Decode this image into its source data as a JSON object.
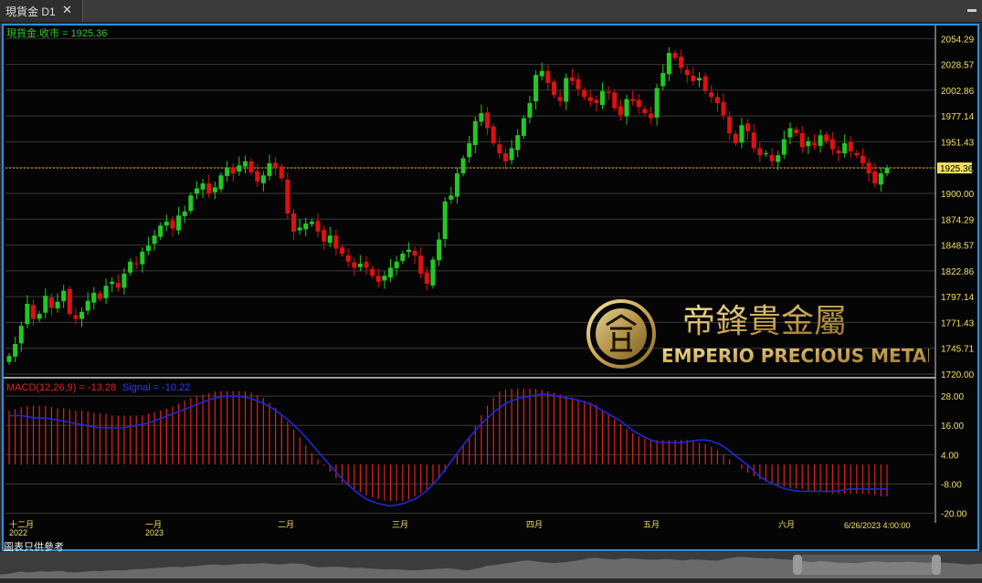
{
  "window": {
    "tab_title": "現貨金 D1",
    "close_glyph": "✕",
    "menu_glyph": "▬"
  },
  "colors": {
    "bull": "#23c823",
    "bear": "#e01010",
    "macd_hist": "#e02020",
    "signal": "#1b2ad8",
    "price_line": "#e0a020",
    "grid": "#3a3a3a",
    "axis_text": "#f0e060"
  },
  "price_panel": {
    "legend": "現貨金.收市 = 1925.36",
    "current_price": "1925.36",
    "y_ticks": [
      "2054.29",
      "2028.57",
      "2002.86",
      "1977.14",
      "1951.43",
      "1925.71",
      "1900.00",
      "1874.29",
      "1848.57",
      "1822.86",
      "1797.14",
      "1771.43",
      "1745.71",
      "1720.00"
    ]
  },
  "macd_panel": {
    "legend_macd": "MACD(12,26,9) = -13.28",
    "legend_signal": "Signal = -10.22",
    "y_ticks": [
      "28.00",
      "16.00",
      "4.00",
      "-8.00",
      "-20.00"
    ]
  },
  "x_axis": {
    "labels": [
      {
        "text": "十二月",
        "sub": "2022"
      },
      {
        "text": "一月",
        "sub": "2023"
      },
      {
        "text": "二月",
        "sub": ""
      },
      {
        "text": "三月",
        "sub": ""
      },
      {
        "text": "四月",
        "sub": ""
      },
      {
        "text": "五月",
        "sub": ""
      },
      {
        "text": "六月",
        "sub": ""
      }
    ],
    "last_timestamp": "6/26/2023 4:00:00"
  },
  "disclaimer": "圖表只供參考",
  "watermark": {
    "chinese": "帝鋒貴金屬",
    "english": "EMPERIO PRECIOUS METALS"
  },
  "chart_data": {
    "type": "candlestick",
    "title": "現貨金 D1",
    "price_ylim": [
      1720,
      2060
    ],
    "closes": [
      1738,
      1750,
      1768,
      1790,
      1775,
      1780,
      1798,
      1786,
      1792,
      1803,
      1780,
      1775,
      1782,
      1793,
      1801,
      1795,
      1808,
      1812,
      1806,
      1820,
      1832,
      1830,
      1842,
      1848,
      1858,
      1868,
      1872,
      1865,
      1878,
      1882,
      1898,
      1905,
      1910,
      1900,
      1906,
      1918,
      1925,
      1920,
      1928,
      1932,
      1921,
      1912,
      1918,
      1930,
      1925,
      1915,
      1880,
      1862,
      1866,
      1870,
      1872,
      1862,
      1852,
      1858,
      1845,
      1840,
      1832,
      1826,
      1830,
      1826,
      1818,
      1812,
      1818,
      1826,
      1832,
      1840,
      1844,
      1838,
      1820,
      1810,
      1834,
      1854,
      1892,
      1898,
      1920,
      1935,
      1950,
      1972,
      1980,
      1965,
      1950,
      1940,
      1932,
      1945,
      1958,
      1975,
      1990,
      2018,
      2022,
      2010,
      1998,
      1992,
      2015,
      2012,
      2004,
      1996,
      1992,
      1990,
      2002,
      2000,
      1985,
      1978,
      1994,
      1992,
      1986,
      1980,
      1975,
      2005,
      2020,
      2040,
      2035,
      2025,
      2018,
      2012,
      2015,
      2002,
      1996,
      1990,
      1978,
      1960,
      1950,
      1968,
      1962,
      1945,
      1938,
      1940,
      1932,
      1938,
      1954,
      1965,
      1960,
      1946,
      1952,
      1948,
      1958,
      1952,
      1944,
      1940,
      1950,
      1942,
      1938,
      1930,
      1920,
      1910,
      1920,
      1925.36
    ],
    "macd_ylim": [
      -22,
      34
    ],
    "macd_hist_sampled": [
      22,
      23,
      24,
      24,
      24,
      23,
      23,
      22,
      22,
      21,
      21,
      20,
      20,
      20,
      20,
      21,
      22,
      23,
      25,
      27,
      28,
      29,
      30,
      30,
      30,
      30,
      29,
      27,
      24,
      20,
      15,
      10,
      5,
      1,
      -3,
      -7,
      -9,
      -11,
      -13,
      -14,
      -15,
      -15,
      -15,
      -13,
      -11,
      -8,
      -4,
      1,
      7,
      13,
      20,
      26,
      30,
      31,
      31,
      31,
      31,
      30,
      29,
      28,
      27,
      26,
      25,
      22,
      19,
      16,
      13,
      11,
      10,
      10,
      10,
      10,
      10,
      9,
      8,
      6,
      3,
      0,
      -3,
      -5,
      -7,
      -8,
      -9,
      -10,
      -10,
      -11,
      -11,
      -12,
      -12,
      -12,
      -12,
      -12,
      -13,
      -13
    ],
    "signal_sampled": [
      20,
      20,
      19,
      19,
      18,
      17,
      16,
      15,
      15,
      15,
      16,
      17,
      19,
      21,
      23,
      25,
      27,
      28,
      28,
      27,
      25,
      22,
      18,
      13,
      7,
      1,
      -5,
      -10,
      -14,
      -16,
      -17,
      -16,
      -14,
      -10,
      -4,
      3,
      10,
      16,
      21,
      25,
      27,
      28,
      29,
      28,
      27,
      26,
      24,
      21,
      18,
      14,
      11,
      9,
      9,
      9,
      10,
      10,
      8,
      4,
      0,
      -5,
      -8,
      -10,
      -11,
      -11,
      -11,
      -11,
      -10,
      -10,
      -10,
      -10
    ]
  }
}
